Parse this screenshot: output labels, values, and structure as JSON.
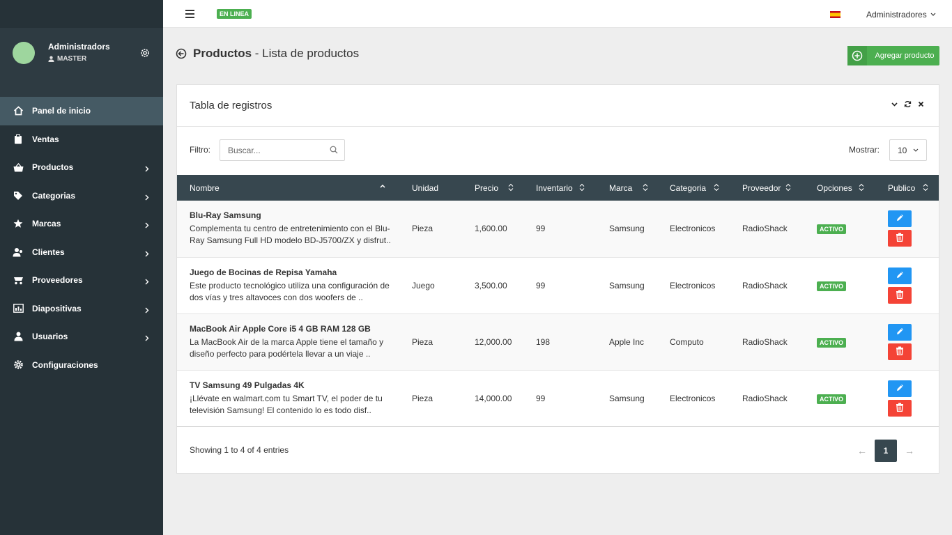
{
  "topbar": {
    "status_badge": "EN LINEA",
    "user_menu": "Administradores"
  },
  "sidebar": {
    "profile": {
      "name": "Administradors",
      "role": "MASTER"
    },
    "items": [
      {
        "label": "Panel de inicio",
        "icon": "home-icon",
        "active": true,
        "has_children": false
      },
      {
        "label": "Ventas",
        "icon": "clipboard-icon",
        "active": false,
        "has_children": false
      },
      {
        "label": "Productos",
        "icon": "basket-icon",
        "active": false,
        "has_children": true
      },
      {
        "label": "Categorias",
        "icon": "tag-icon",
        "active": false,
        "has_children": true
      },
      {
        "label": "Marcas",
        "icon": "star-icon",
        "active": false,
        "has_children": true
      },
      {
        "label": "Clientes",
        "icon": "clients-icon",
        "active": false,
        "has_children": true
      },
      {
        "label": "Proveedores",
        "icon": "truck-icon",
        "active": false,
        "has_children": true
      },
      {
        "label": "Diapositivas",
        "icon": "slides-icon",
        "active": false,
        "has_children": true
      },
      {
        "label": "Usuarios",
        "icon": "user-icon",
        "active": false,
        "has_children": true
      },
      {
        "label": "Configuraciones",
        "icon": "gear-icon",
        "active": false,
        "has_children": false
      }
    ]
  },
  "page": {
    "title": "Productos",
    "subtitle": " - Lista de productos",
    "add_button": "Agregar producto"
  },
  "card": {
    "title": "Tabla de registros",
    "filter_label": "Filtro:",
    "search_placeholder": "Buscar...",
    "show_label": "Mostrar:",
    "show_value": "10"
  },
  "table": {
    "columns": [
      "Nombre",
      "Unidad",
      "Precio",
      "Inventario",
      "Marca",
      "Categoria",
      "Proveedor",
      "Opciones",
      "Publico"
    ],
    "rows": [
      {
        "name": "Blu-Ray Samsung",
        "desc": "Complementa tu centro de entretenimiento con el Blu-Ray Samsung Full HD modelo BD-J5700/ZX y disfrut..",
        "unit": "Pieza",
        "price": "1,600.00",
        "stock": "99",
        "brand": "Samsung",
        "category": "Electronicos",
        "supplier": "RadioShack",
        "status": "ACTIVO"
      },
      {
        "name": "Juego de Bocinas de Repisa Yamaha",
        "desc": "Este producto tecnológico utiliza una configuración de dos vías y tres altavoces con dos woofers de ..",
        "unit": "Juego",
        "price": "3,500.00",
        "stock": "99",
        "brand": "Samsung",
        "category": "Electronicos",
        "supplier": "RadioShack",
        "status": "ACTIVO"
      },
      {
        "name": "MacBook Air Apple Core i5 4 GB RAM 128 GB",
        "desc": "La MacBook Air de la marca Apple tiene el tamaño y diseño perfecto para podértela llevar a un viaje ..",
        "unit": "Pieza",
        "price": "12,000.00",
        "stock": "198",
        "brand": "Apple Inc",
        "category": "Computo",
        "supplier": "RadioShack",
        "status": "ACTIVO"
      },
      {
        "name": "TV Samsung 49 Pulgadas 4K",
        "desc": "¡Llévate en walmart.com tu Smart TV, el poder de tu televisión Samsung! El contenido lo es todo disf..",
        "unit": "Pieza",
        "price": "14,000.00",
        "stock": "99",
        "brand": "Samsung",
        "category": "Electronicos",
        "supplier": "RadioShack",
        "status": "ACTIVO"
      }
    ]
  },
  "footer": {
    "entries": "Showing 1 to 4 of 4 entries",
    "prev": "←",
    "page": "1",
    "next": "→"
  },
  "colors": {
    "sidebar_bg": "#263238",
    "active_item": "#455a64",
    "header_row": "#37474f",
    "success": "#4caf50",
    "edit": "#2196f3",
    "delete": "#f44336"
  }
}
